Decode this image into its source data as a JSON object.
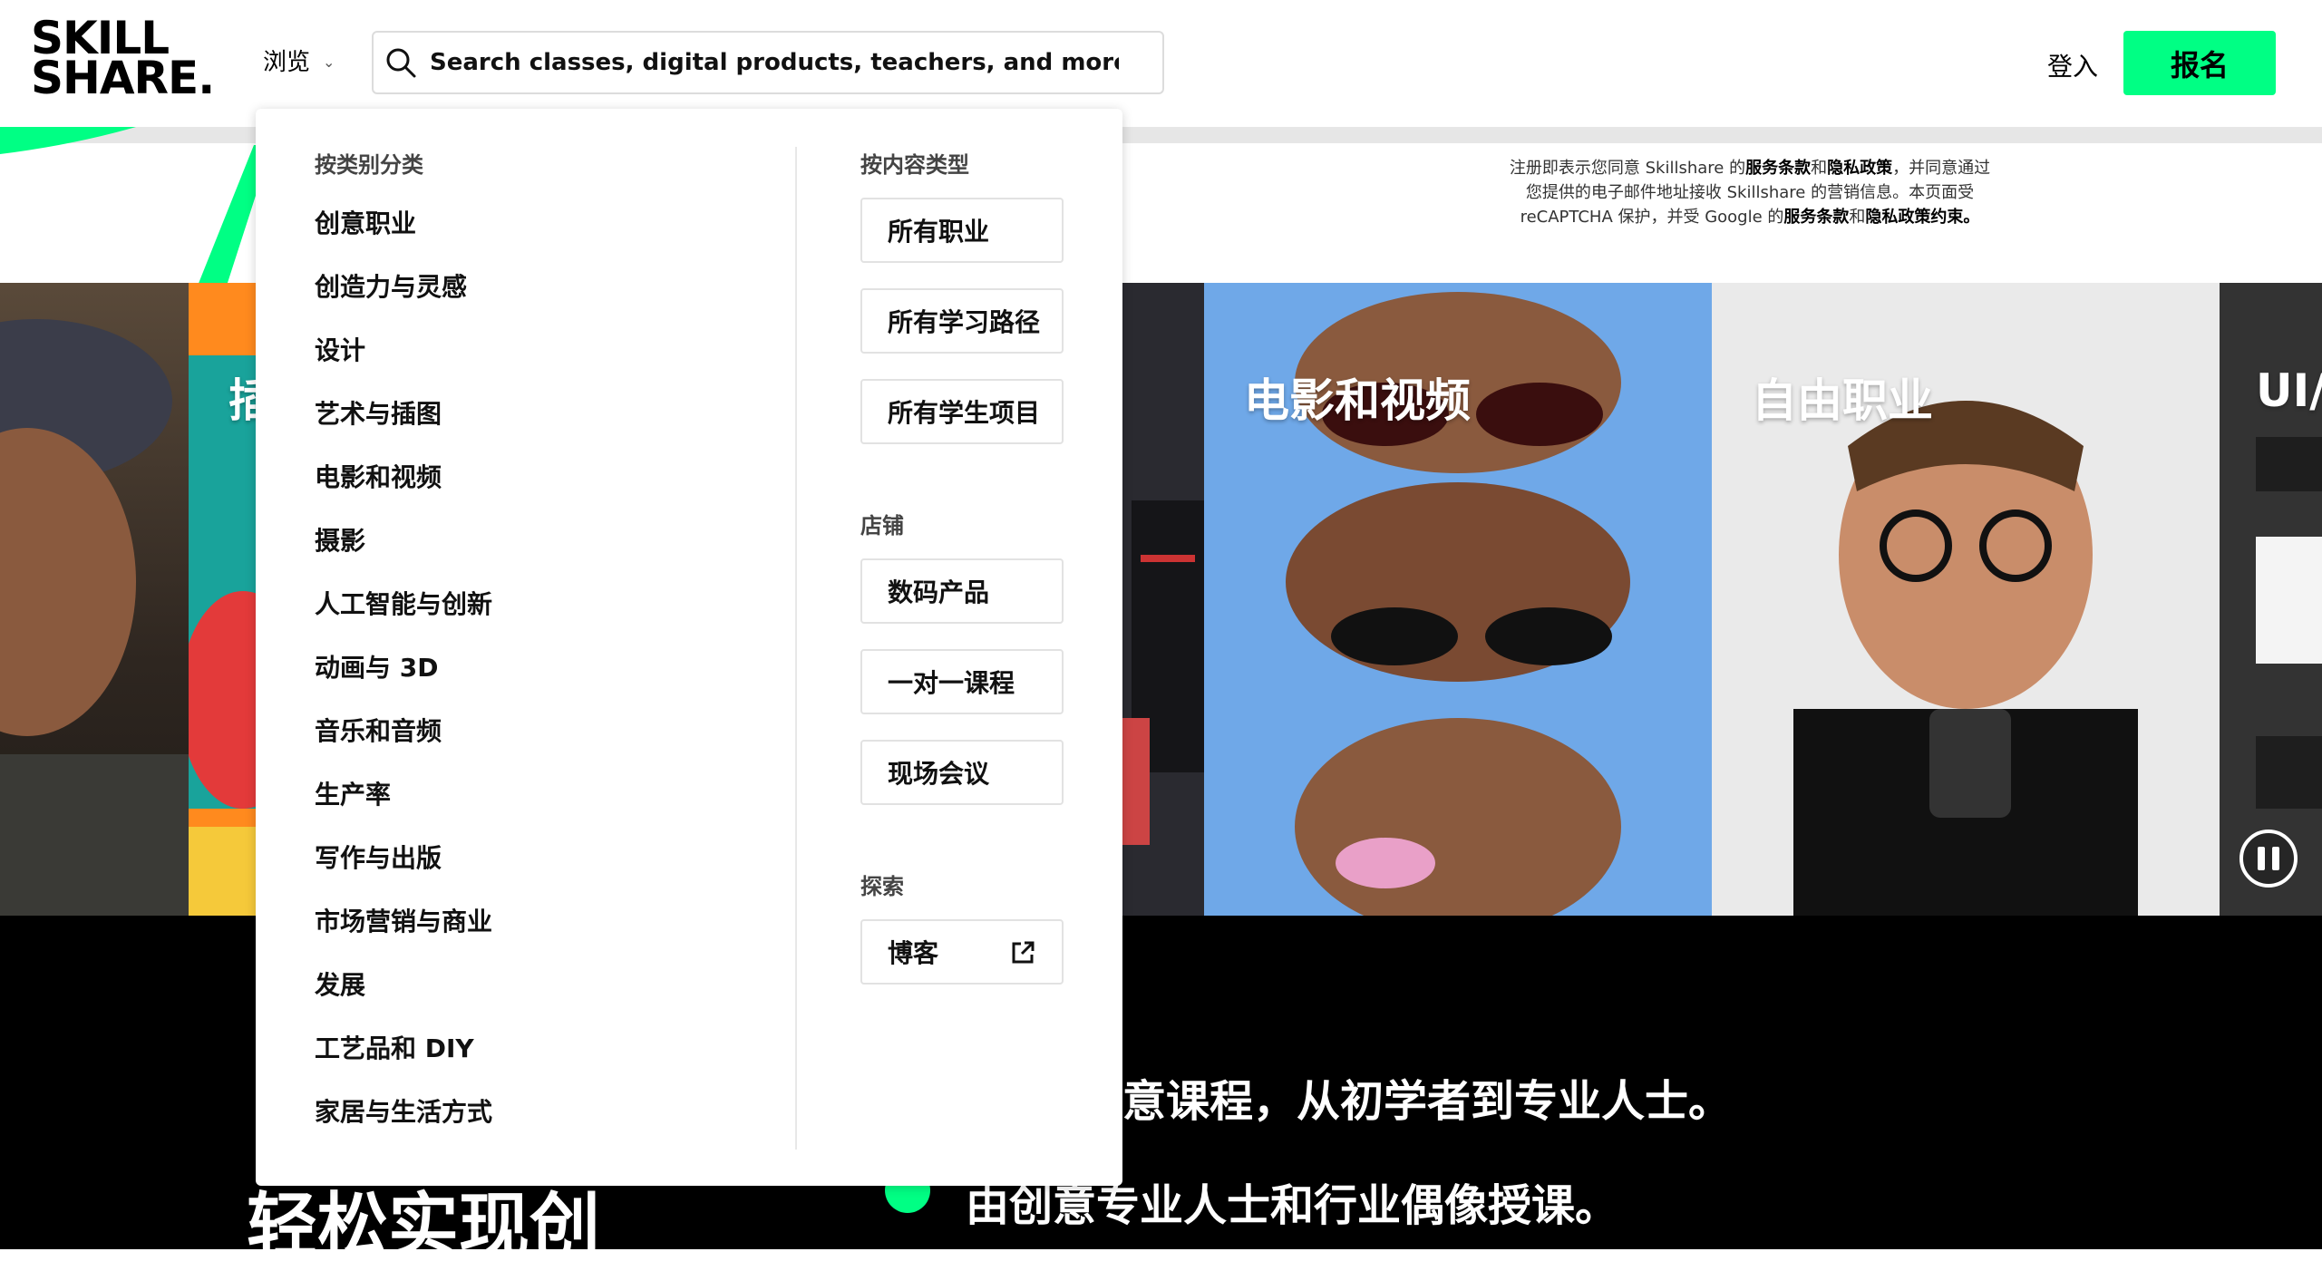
{
  "header": {
    "logo_line1": "SKILL",
    "logo_line2": "SHARE.",
    "browse_label": "浏览",
    "search_placeholder": "Search classes, digital products, teachers, and more",
    "login_label": "登入",
    "signup_label": "报名"
  },
  "legal": {
    "line1_prefix": "注册即表示您同意 Skillshare 的",
    "terms": "服务条款",
    "and": "和",
    "privacy": "隐私政策",
    "line1_suffix": "，并同意通过",
    "line2": "您提供的电子邮件地址接收 Skillshare 的营销信息。本页面受",
    "line3_prefix": "reCAPTCHA 保护，并受 Google 的",
    "terms2": "服务条款",
    "and2": "和",
    "privacy2": "隐私政策约束。"
  },
  "tiles": [
    {
      "label": ""
    },
    {
      "label": "插"
    },
    {
      "label": ""
    },
    {
      "label": "电影和视频"
    },
    {
      "label": "自由职业"
    },
    {
      "label": "UI/"
    }
  ],
  "features": [
    {
      "text": "创意课程，从初学者到专业人士。"
    },
    {
      "text": "由创意专业人士和行业偶像授课。"
    }
  ],
  "big_heading": "轻松实现创",
  "dropdown": {
    "categories_title": "按类别分类",
    "categories": [
      "创意职业",
      "创造力与灵感",
      "设计",
      "艺术与插图",
      "电影和视频",
      "摄影",
      "人工智能与创新",
      "动画与 3D",
      "音乐和音频",
      "生产率",
      "写作与出版",
      "市场营销与商业",
      "发展",
      "工艺品和 DIY",
      "家居与生活方式"
    ],
    "content_title": "按内容类型",
    "content_types": [
      "所有职业",
      "所有学习路径",
      "所有学生项目"
    ],
    "store_title": "店铺",
    "store_items": [
      "数码产品",
      "一对一课程",
      "现场会议"
    ],
    "explore_title": "探索",
    "explore_items": [
      "博客"
    ]
  },
  "colors": {
    "brand_green": "#00ff84",
    "black": "#000000"
  }
}
